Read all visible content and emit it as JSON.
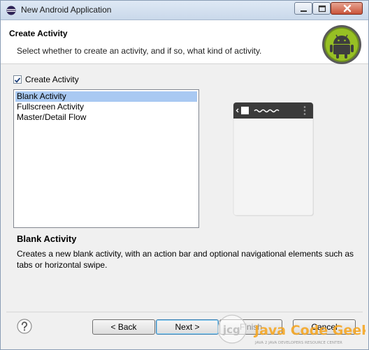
{
  "window": {
    "title": "New Android Application",
    "controls": [
      "minimize-icon",
      "maximize-icon",
      "close-icon"
    ]
  },
  "header": {
    "title": "Create Activity",
    "description": "Select whether to create an activity, and if so, what kind of activity.",
    "logo_icon": "android-logo-icon"
  },
  "create_activity": {
    "label": "Create Activity",
    "checked": true
  },
  "templates": {
    "selected_index": 0,
    "items": [
      {
        "label": "Blank Activity"
      },
      {
        "label": "Fullscreen Activity"
      },
      {
        "label": "Master/Detail Flow"
      }
    ]
  },
  "detail": {
    "title": "Blank Activity",
    "description": "Creates a new blank activity, with an action bar and optional navigational elements such as tabs or horizontal swipe."
  },
  "footer": {
    "back_label": "< Back",
    "next_label": "Next >",
    "finish_label": "Finish",
    "cancel_label": "Cancel"
  },
  "watermark": {
    "brand": "Java Code Geeks",
    "tagline": "JAVA 2 JAVA DEVELOPERS RESOURCE CENTER"
  },
  "colors": {
    "selection": "#a9c9f2",
    "android_green": "#97c024",
    "watermark_orange": "#f5a623"
  }
}
